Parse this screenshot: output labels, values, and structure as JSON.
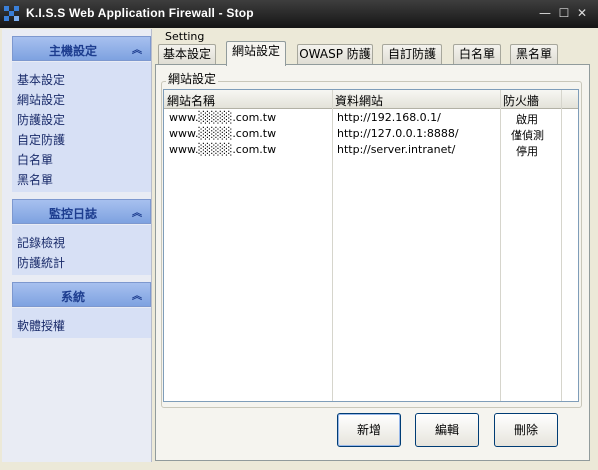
{
  "window": {
    "title": "K.I.S.S Web Application Firewall - Stop",
    "minimize": "—",
    "maximize": "☐",
    "close": "✕"
  },
  "sidebar": {
    "groups": [
      {
        "title": "主機設定",
        "chevron": "⌃⌃",
        "items": [
          "基本設定",
          "網站設定",
          "防護設定",
          "自定防護",
          "白名單",
          "黑名單"
        ]
      },
      {
        "title": "監控日誌",
        "chevron": "⌃⌃",
        "items": [
          "記錄檢視",
          "防護統計"
        ]
      },
      {
        "title": "系統",
        "chevron": "⌃⌃",
        "items": [
          "軟體授權"
        ]
      }
    ]
  },
  "main": {
    "section_label": "Setting",
    "tabs": [
      "基本設定",
      "網站設定",
      "OWASP 防護",
      "自訂防護",
      "白名單",
      "黑名單"
    ],
    "active_tab": "網站設定",
    "fieldset_legend": "網站設定",
    "table": {
      "columns": [
        "網站名稱",
        "資料網站",
        "防火牆"
      ],
      "rows": [
        [
          "www.░░░░.com.tw",
          "http://192.168.0.1/",
          "啟用"
        ],
        [
          "www.░░░░.com.tw",
          "http://127.0.0.1:8888/",
          "僅偵測"
        ],
        [
          "www.░░░░.com.tw",
          "http://server.intranet/",
          "停用"
        ]
      ]
    },
    "buttons": {
      "add": "新增",
      "edit": "編輯",
      "delete": "刪除"
    }
  }
}
